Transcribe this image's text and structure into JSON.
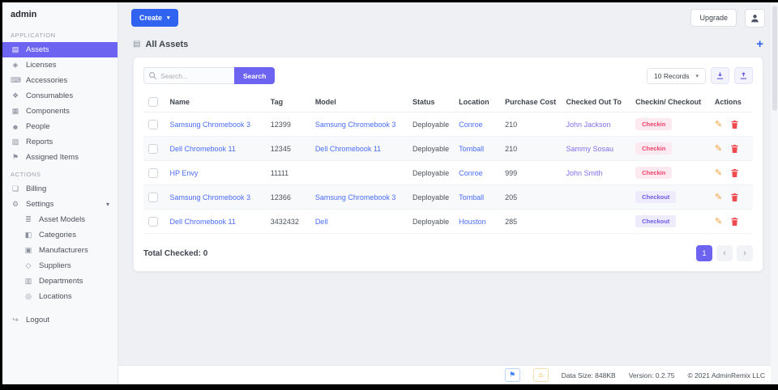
{
  "brand": "admin",
  "icons": {
    "assets": "▤",
    "licenses": "◈",
    "accessories": "⌨",
    "consumables": "❖",
    "components": "▦",
    "people": "☻",
    "reports": "▨",
    "assigned": "⚑",
    "billing": "❏",
    "settings": "⚙",
    "asset_models": "≣",
    "categories": "◧",
    "manufacturers": "▣",
    "suppliers": "◇",
    "departments": "▥",
    "locations": "◎",
    "logout": "↪",
    "caret": "▾",
    "page_icon": "▤",
    "plus": "+",
    "edit": "✎",
    "chevron_left": "‹",
    "chevron_right": "›",
    "flag": "⚑",
    "home": "⌂"
  },
  "sidebar": {
    "sections": {
      "application": "APPLICATION",
      "actions": "ACTIONS"
    },
    "app_items": [
      {
        "label": "Assets"
      },
      {
        "label": "Licenses"
      },
      {
        "label": "Accessories"
      },
      {
        "label": "Consumables"
      },
      {
        "label": "Components"
      },
      {
        "label": "People"
      },
      {
        "label": "Reports"
      },
      {
        "label": "Assigned Items"
      }
    ],
    "action_items": [
      {
        "label": "Billing"
      },
      {
        "label": "Settings"
      }
    ],
    "settings_subitems": [
      {
        "label": "Asset Models"
      },
      {
        "label": "Categories"
      },
      {
        "label": "Manufacturers"
      },
      {
        "label": "Suppliers"
      },
      {
        "label": "Departments"
      },
      {
        "label": "Locations"
      }
    ],
    "logout_label": "Logout"
  },
  "topbar": {
    "create_label": "Create",
    "upgrade_label": "Upgrade"
  },
  "page": {
    "title": "All Assets"
  },
  "toolbar": {
    "search_placeholder": "Search...",
    "search_button": "Search",
    "records": "10 Records"
  },
  "table": {
    "headers": [
      "Name",
      "Tag",
      "Model",
      "Status",
      "Location",
      "Purchase Cost",
      "Checked Out To",
      "Checkin/ Checkout",
      "Actions"
    ],
    "rows": [
      {
        "name": "Samsung Chromebook 3",
        "tag": "12399",
        "model": "Samsung Chromebook 3",
        "status": "Deployable",
        "location": "Conroe",
        "cost": "210",
        "checked_out_to": "John Jackson",
        "badge": "Checkin"
      },
      {
        "name": "Dell Chromebook 11",
        "tag": "12345",
        "model": "Dell Chromebook 11",
        "status": "Deployable",
        "location": "Tomball",
        "cost": "210",
        "checked_out_to": "Sammy Sosau",
        "badge": "Checkin"
      },
      {
        "name": "HP Envy",
        "tag": "11111",
        "model": "",
        "status": "Deployable",
        "location": "Conroe",
        "cost": "999",
        "checked_out_to": "John Smith",
        "badge": "Checkin"
      },
      {
        "name": "Samsung Chromebook 3",
        "tag": "12366",
        "model": "Samsung Chromebook 3",
        "status": "Deployable",
        "location": "Tomball",
        "cost": "205",
        "checked_out_to": "",
        "badge": "Checkout"
      },
      {
        "name": "Dell Chromebook 11",
        "tag": "3432432",
        "model": "Dell",
        "status": "Deployable",
        "location": "Houston",
        "cost": "285",
        "checked_out_to": "",
        "badge": "Checkout"
      }
    ]
  },
  "summary": {
    "total_checked_label": "Total Checked:",
    "total_checked_value": "0"
  },
  "pagination": {
    "page": "1"
  },
  "statusbar": {
    "data_size": "Data Size: 848KB",
    "version": "Version: 0.2.75",
    "copyright": "© 2021 AdminRemix LLC"
  },
  "colors": {
    "primary": "#6c63f1",
    "create_blue": "#2f63f0",
    "link_blue": "#4a6cf7",
    "checked_out_purple": "#8070e8",
    "checkin_red": "#f1416c",
    "checkout_purple": "#6c5ce7",
    "edit_orange": "#f0a13c",
    "delete_red": "#ee4b50"
  }
}
